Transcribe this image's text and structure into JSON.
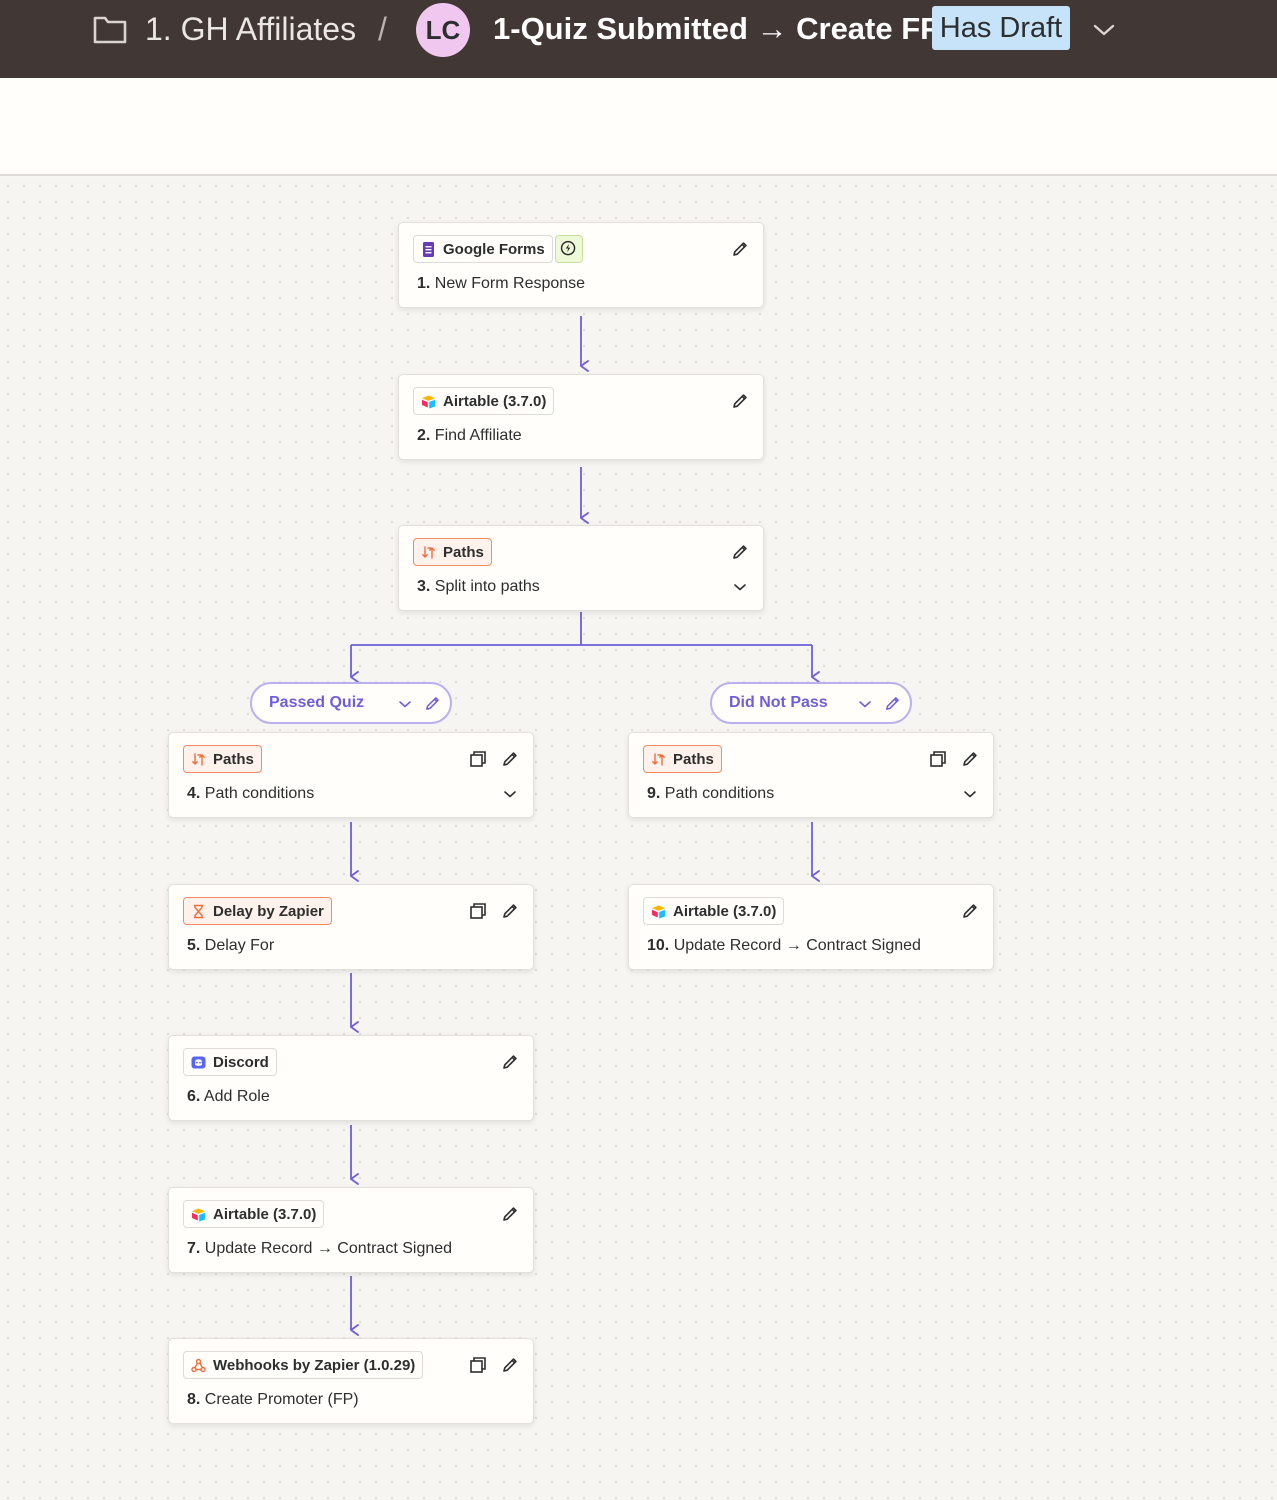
{
  "header": {
    "folder_name": "1. GH Affiliates",
    "separator": "/",
    "avatar_initials": "LC",
    "zap_title": "1-Quiz Submitted → Create FP",
    "draft_badge": "Has Draft"
  },
  "colors": {
    "topbar": "#413735",
    "connector": "#6e5fd9",
    "path_border": "#b9b0f0",
    "orange_chip": "#f28b5e",
    "avatar": "#f0c7ee",
    "draft": "#c6e3f9"
  },
  "steps": {
    "s1": {
      "app": "Google Forms",
      "num": "1.",
      "title": "New Form Response",
      "icon": "google-forms-icon"
    },
    "s2": {
      "app": "Airtable (3.7.0)",
      "num": "2.",
      "title": "Find Affiliate",
      "icon": "airtable-icon"
    },
    "s3": {
      "app": "Paths",
      "num": "3.",
      "title": "Split into paths",
      "icon": "paths-icon"
    },
    "s4": {
      "app": "Paths",
      "num": "4.",
      "title": "Path conditions",
      "icon": "paths-icon"
    },
    "s5": {
      "app": "Delay by Zapier",
      "num": "5.",
      "title": "Delay For",
      "icon": "hourglass-icon"
    },
    "s6": {
      "app": "Discord",
      "num": "6.",
      "title": "Add Role",
      "icon": "discord-icon"
    },
    "s7": {
      "app": "Airtable (3.7.0)",
      "num": "7.",
      "title": "Update Record → Contract Signed",
      "icon": "airtable-icon"
    },
    "s8": {
      "app": "Webhooks by Zapier (1.0.29)",
      "num": "8.",
      "title": "Create Promoter (FP)",
      "icon": "webhook-icon"
    },
    "s9": {
      "app": "Paths",
      "num": "9.",
      "title": "Path conditions",
      "icon": "paths-icon"
    },
    "s10": {
      "app": "Airtable (3.7.0)",
      "num": "10.",
      "title": "Update Record → Contract Signed",
      "icon": "airtable-icon"
    }
  },
  "paths": {
    "a": {
      "label": "Passed Quiz"
    },
    "b": {
      "label": "Did Not Pass"
    }
  }
}
